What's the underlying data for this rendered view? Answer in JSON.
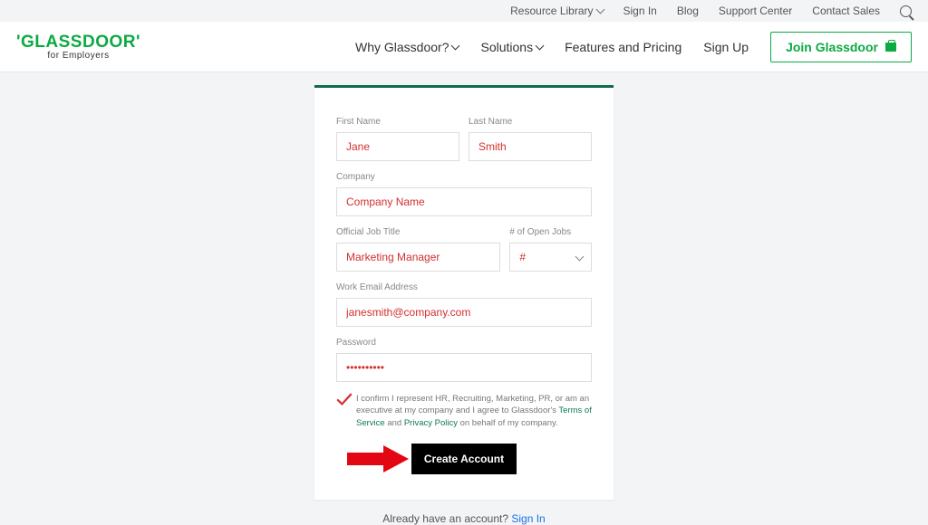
{
  "topbar": {
    "resource_library": "Resource Library",
    "sign_in": "Sign In",
    "blog": "Blog",
    "support_center": "Support Center",
    "contact_sales": "Contact Sales"
  },
  "logo": {
    "main": "'GLASSDOOR'",
    "sub": "for Employers"
  },
  "nav": {
    "why": "Why Glassdoor?",
    "solutions": "Solutions",
    "features": "Features and Pricing",
    "signup": "Sign Up",
    "join": "Join Glassdoor"
  },
  "form": {
    "first_name": {
      "label": "First Name",
      "value": "Jane"
    },
    "last_name": {
      "label": "Last Name",
      "value": "Smith"
    },
    "company": {
      "label": "Company",
      "value": "Company Name"
    },
    "job_title": {
      "label": "Official Job Title",
      "value": "Marketing Manager"
    },
    "open_jobs": {
      "label": "# of Open Jobs",
      "value": "#"
    },
    "email": {
      "label": "Work Email Address",
      "value": "janesmith@company.com"
    },
    "password": {
      "label": "Password",
      "value": "••••••••••"
    },
    "consent_a": "I confirm I represent HR, Recruiting, Marketing, PR, or am an executive at my company and I agree to Glassdoor's ",
    "terms": "Terms of Service",
    "and": " and ",
    "privacy": "Privacy Policy",
    "consent_b": " on behalf of my company.",
    "submit": "Create Account"
  },
  "footer": {
    "already": "Already have an account? ",
    "sign_in": "Sign In"
  }
}
